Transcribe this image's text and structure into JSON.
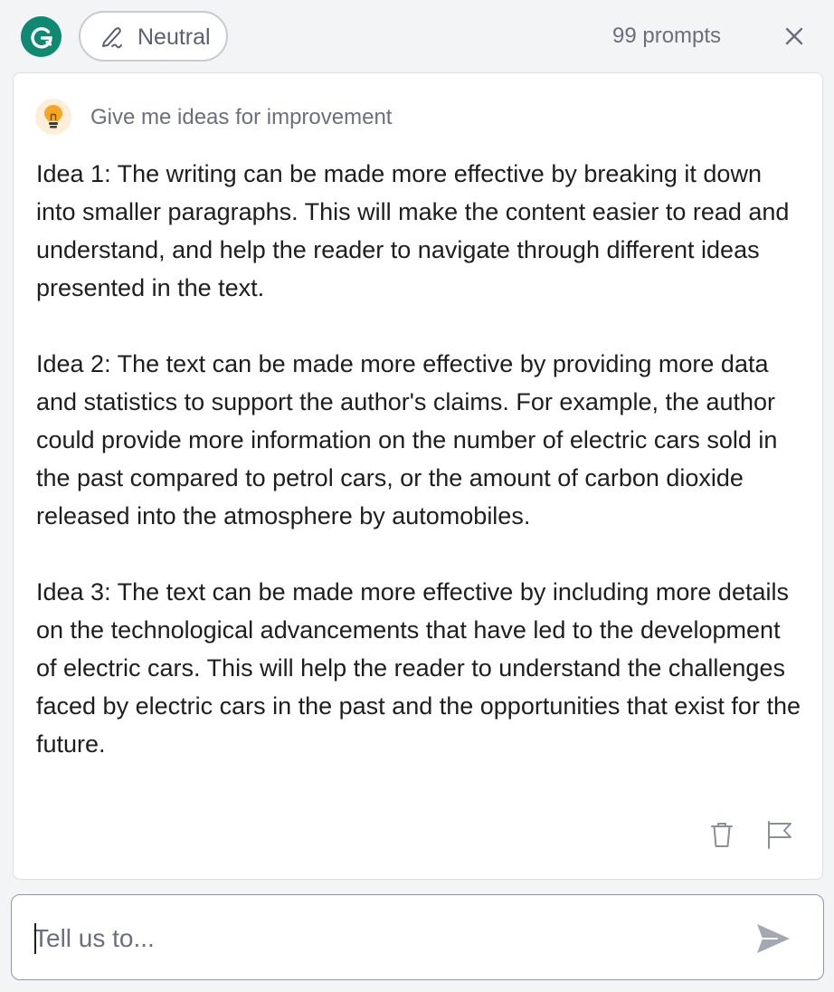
{
  "header": {
    "logo_letter": "G",
    "tone_label": "Neutral",
    "prompts_count": "99 prompts",
    "icons": {
      "logo": "grammarly-logo-icon",
      "pen": "pen-icon",
      "close": "close-icon"
    }
  },
  "card": {
    "prompt": "Give me ideas for improvement",
    "prompt_icon": "lightbulb-icon",
    "ideas": [
      "Idea 1: The writing can be made more effective by breaking it down into smaller paragraphs. This will make the content easier to read and understand, and help the reader to navigate through different ideas presented in the text.",
      "Idea 2: The text can be made more effective by providing more data and statistics to support the author's claims. For example, the author could provide more information on the number of electric cars sold in the past compared to petrol cars, or the amount of carbon dioxide released into the atmosphere by automobiles.",
      "Idea 3: The text can be made more effective by including more details on the technological advancements that have led to the development of electric cars. This will help the reader to understand the challenges faced by electric cars in the past and the opportunities that exist for the future."
    ],
    "actions": {
      "delete_icon": "trash-icon",
      "flag_icon": "flag-icon"
    }
  },
  "input": {
    "placeholder": "Tell us to...",
    "value": "",
    "send_icon": "send-icon"
  },
  "colors": {
    "brand": "#0f8a72",
    "background": "#f3f4f6",
    "muted_text": "#6b6e7c",
    "bulb_bg": "#fdeeda",
    "bulb_fill": "#f5a623"
  }
}
